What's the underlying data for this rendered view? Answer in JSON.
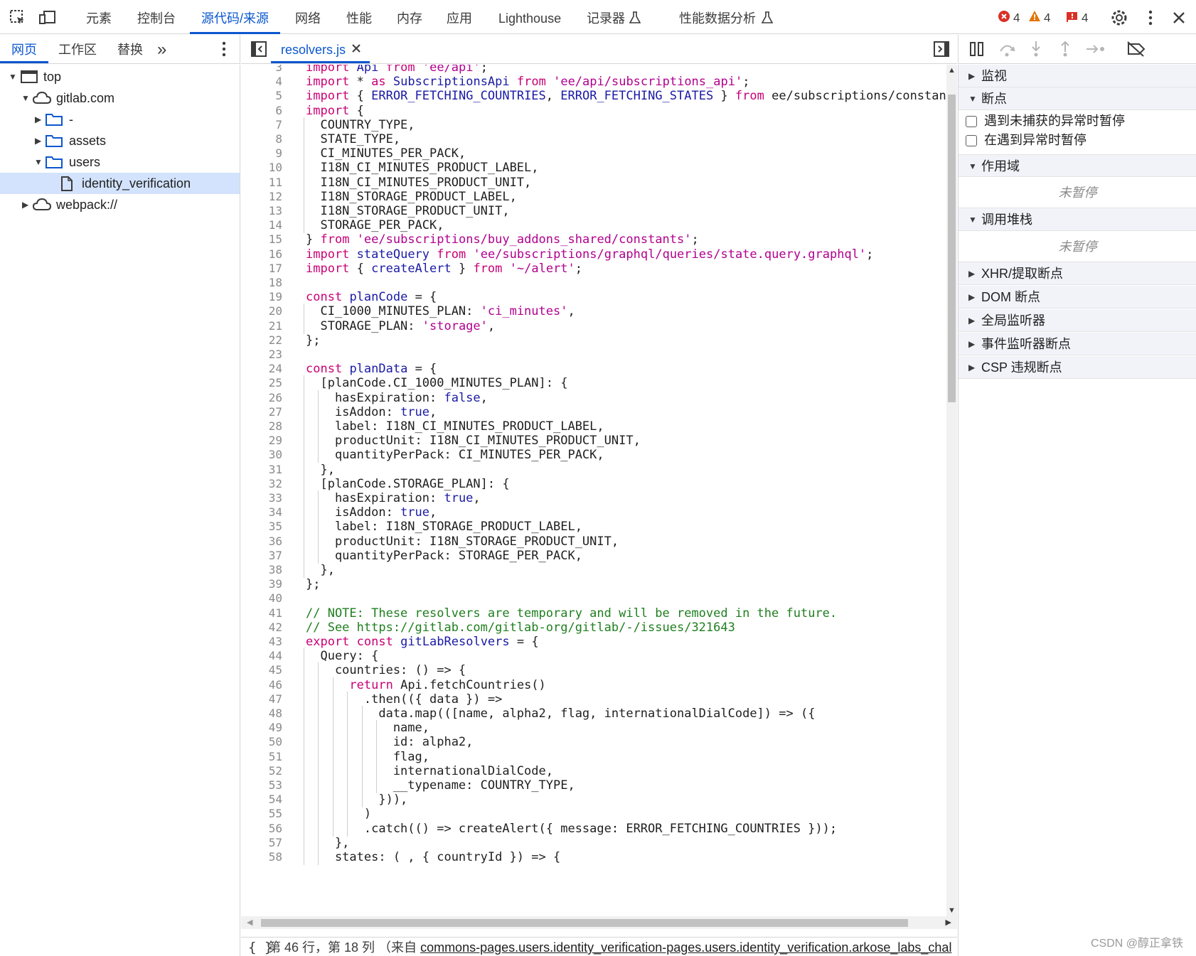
{
  "top_tabs": [
    "元素",
    "控制台",
    "源代码/来源",
    "网络",
    "性能",
    "内存",
    "应用",
    "Lighthouse",
    "记录器",
    "性能数据分析"
  ],
  "active_top_tab": "源代码/来源",
  "counters": {
    "errors": "4",
    "warnings": "4",
    "issues": "4"
  },
  "colors": {
    "accent": "#0b57d0",
    "error": "#d93025",
    "warning": "#e37400",
    "issue": "#d93025"
  },
  "navigator": {
    "tabs": [
      "网页",
      "工作区",
      "替换"
    ],
    "more": "»",
    "tree": [
      {
        "label": "top",
        "icon": "frame-icon",
        "expanded": true
      },
      {
        "label": "gitlab.com",
        "icon": "cloud-icon",
        "expanded": true
      },
      {
        "label": "-",
        "icon": "folder-icon",
        "expanded": false
      },
      {
        "label": "assets",
        "icon": "folder-icon",
        "expanded": false
      },
      {
        "label": "users",
        "icon": "folder-icon",
        "expanded": true
      },
      {
        "label": "identity_verification",
        "icon": "file-icon",
        "selected": true
      },
      {
        "label": "webpack://",
        "icon": "cloud-icon",
        "expanded": false
      }
    ]
  },
  "editor": {
    "file_tab": "resolvers.js",
    "first_line": 3,
    "lines": [
      "import Api from 'ee/api';",
      "import * as SubscriptionsApi from 'ee/api/subscriptions_api';",
      "import { ERROR_FETCHING_COUNTRIES, ERROR_FETCHING_STATES } from 'ee/subscriptions/constant",
      "import {",
      "  COUNTRY_TYPE,",
      "  STATE_TYPE,",
      "  CI_MINUTES_PER_PACK,",
      "  I18N_CI_MINUTES_PRODUCT_LABEL,",
      "  I18N_CI_MINUTES_PRODUCT_UNIT,",
      "  I18N_STORAGE_PRODUCT_LABEL,",
      "  I18N_STORAGE_PRODUCT_UNIT,",
      "  STORAGE_PER_PACK,",
      "} from 'ee/subscriptions/buy_addons_shared/constants';",
      "import stateQuery from 'ee/subscriptions/graphql/queries/state.query.graphql';",
      "import { createAlert } from '~/alert';",
      "",
      "const planCode = {",
      "  CI_1000_MINUTES_PLAN: 'ci_minutes',",
      "  STORAGE_PLAN: 'storage',",
      "};",
      "",
      "const planData = {",
      "  [planCode.CI_1000_MINUTES_PLAN]: {",
      "    hasExpiration: false,",
      "    isAddon: true,",
      "    label: I18N_CI_MINUTES_PRODUCT_LABEL,",
      "    productUnit: I18N_CI_MINUTES_PRODUCT_UNIT,",
      "    quantityPerPack: CI_MINUTES_PER_PACK,",
      "  },",
      "  [planCode.STORAGE_PLAN]: {",
      "    hasExpiration: true,",
      "    isAddon: true,",
      "    label: I18N_STORAGE_PRODUCT_LABEL,",
      "    productUnit: I18N_STORAGE_PRODUCT_UNIT,",
      "    quantityPerPack: STORAGE_PER_PACK,",
      "  },",
      "};",
      "",
      "// NOTE: These resolvers are temporary and will be removed in the future.",
      "// See https://gitlab.com/gitlab-org/gitlab/-/issues/321643",
      "export const gitLabResolvers = {",
      "  Query: {",
      "    countries: () => {",
      "      return Api.fetchCountries()",
      "        .then(({ data }) =>",
      "          data.map(([name, alpha2, flag, internationalDialCode]) => ({",
      "            name,",
      "            id: alpha2,",
      "            flag,",
      "            internationalDialCode,",
      "            __typename: COUNTRY_TYPE,",
      "          })),",
      "        )",
      "        .catch(() => createAlert({ message: ERROR_FETCHING_COUNTRIES }));",
      "    },",
      "    states: ( , { countryId }) => {"
    ],
    "status": "第 46 行，第 18 列  （来自 commons-pages.users.identity_verification-pages.users.identity_verification.arkose_labs_chal"
  },
  "debugger": {
    "sections": [
      {
        "label": "监视",
        "expanded": false
      },
      {
        "label": "断点",
        "expanded": true
      },
      {
        "label": "作用域",
        "expanded": true
      },
      {
        "label": "调用堆栈",
        "expanded": true
      },
      {
        "label": "XHR/提取断点",
        "expanded": false
      },
      {
        "label": "DOM 断点",
        "expanded": false
      },
      {
        "label": "全局监听器",
        "expanded": false
      },
      {
        "label": "事件监听器断点",
        "expanded": false
      },
      {
        "label": "CSP 违规断点",
        "expanded": false
      }
    ],
    "checkboxes": [
      "遇到未捕获的异常时暂停",
      "在遇到异常时暂停"
    ],
    "not_paused": "未暂停"
  },
  "watermark": "CSDN @醇正拿铁"
}
